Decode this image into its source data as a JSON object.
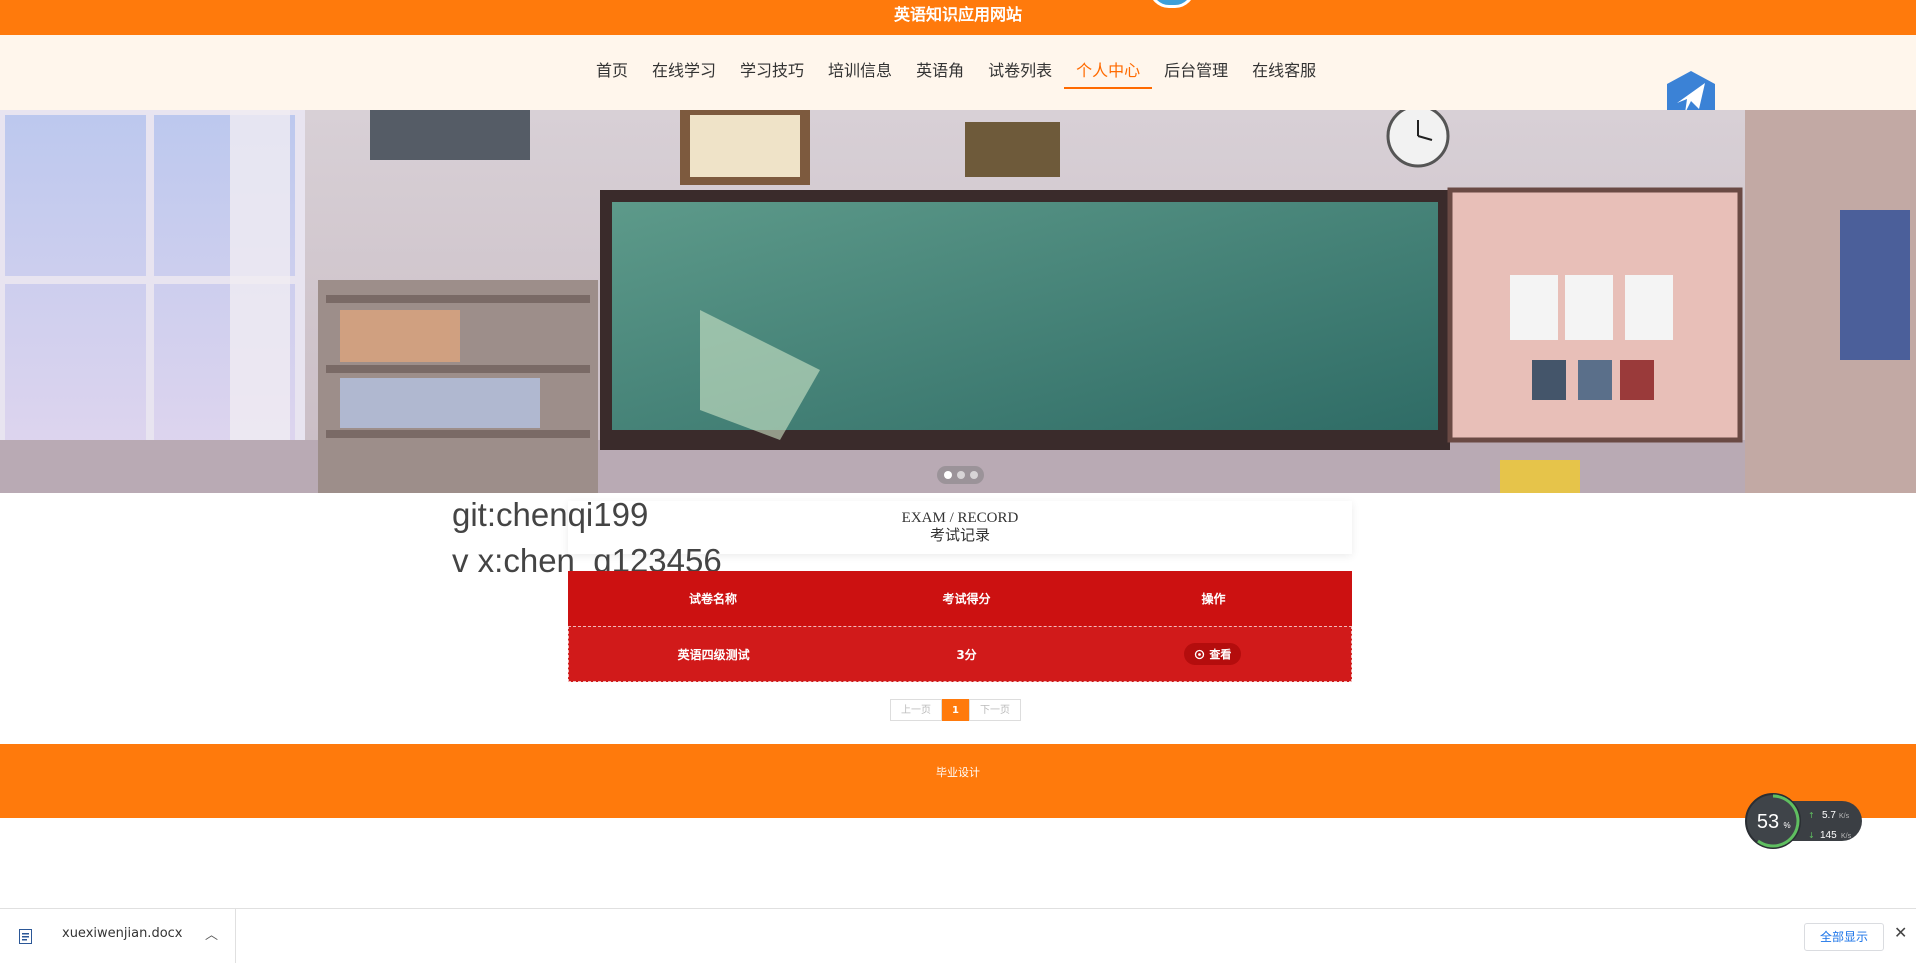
{
  "site": {
    "title": "英语知识应用网站"
  },
  "nav": {
    "items": [
      {
        "label": "首页"
      },
      {
        "label": "在线学习"
      },
      {
        "label": "学习技巧"
      },
      {
        "label": "培训信息"
      },
      {
        "label": "英语角"
      },
      {
        "label": "试卷列表"
      },
      {
        "label": "个人中心",
        "active": true
      },
      {
        "label": "后台管理"
      },
      {
        "label": "在线客服"
      }
    ]
  },
  "watermark": {
    "line1": "git:chenqi199",
    "line2": "v x:chen_q123456"
  },
  "section": {
    "en": "EXAM / RECORD",
    "cn": "考试记录"
  },
  "table": {
    "headers": [
      "试卷名称",
      "考试得分",
      "操作"
    ],
    "rows": [
      {
        "name": "英语四级测试",
        "score": "3分",
        "action": "查看"
      }
    ]
  },
  "pager": {
    "prev": "上一页",
    "current": "1",
    "next": "下一页"
  },
  "footer": {
    "text": "毕业设计"
  },
  "speed_widget": {
    "percent": "53",
    "percent_unit": "%",
    "up": "5.7",
    "up_unit": "K/s",
    "down": "145",
    "down_unit": "K/s"
  },
  "downloads": {
    "file_name": "xuexiwenjian.docx",
    "show_all": "全部显示",
    "close": "✕",
    "chevron": "︿"
  },
  "colors": {
    "accent": "#ff7a0c",
    "table_red": "#cc1111"
  }
}
